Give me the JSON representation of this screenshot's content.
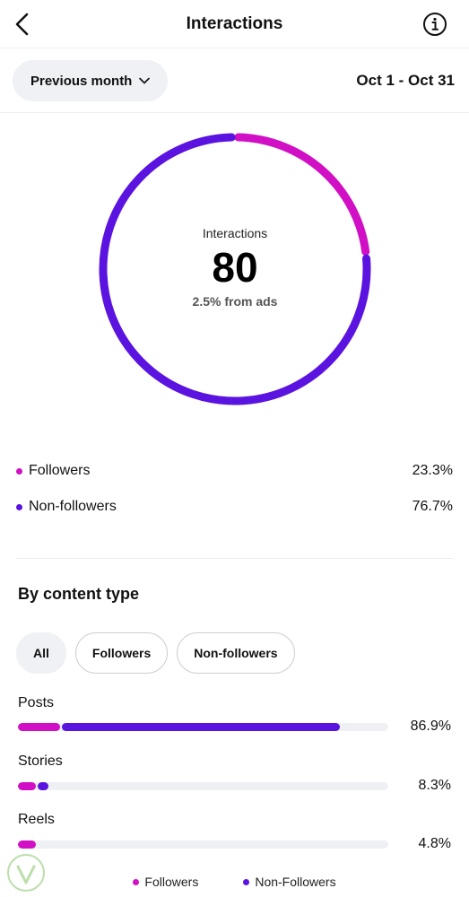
{
  "colors": {
    "followers": "#d10fc4",
    "non_followers": "#5b13e0",
    "track": "#eef0f3"
  },
  "header": {
    "title": "Interactions"
  },
  "filter": {
    "period_label": "Previous month",
    "date_range": "Oct 1 - Oct 31"
  },
  "summary": {
    "label": "Interactions",
    "total": "80",
    "ads_note": "2.5% from ads",
    "segments": [
      {
        "name": "Followers",
        "percent_label": "23.3%",
        "value": 23.3
      },
      {
        "name": "Non-followers",
        "percent_label": "76.7%",
        "value": 76.7
      }
    ]
  },
  "content_type": {
    "title": "By content type",
    "filters": [
      "All",
      "Followers",
      "Non-followers"
    ],
    "selected_filter": "All",
    "rows": [
      {
        "label": "Posts",
        "percent_label": "86.9%",
        "followers": 11.5,
        "non_followers": 75.4
      },
      {
        "label": "Stories",
        "percent_label": "8.3%",
        "followers": 4.8,
        "non_followers": 3.5
      },
      {
        "label": "Reels",
        "percent_label": "4.8%",
        "followers": 4.8,
        "non_followers": 0
      }
    ],
    "legend": [
      "Followers",
      "Non-Followers"
    ]
  }
}
